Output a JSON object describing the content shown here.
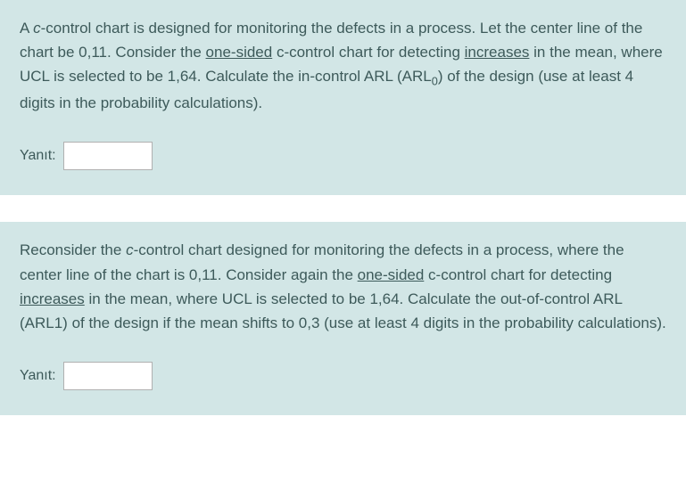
{
  "question1": {
    "text_parts": {
      "p1": "A ",
      "p2": "c",
      "p3": "-control chart is designed for monitoring the defects in a process. Let the center line of the chart be 0,11. Consider the ",
      "p4": "one-sided",
      "p5": " c-control chart for detecting ",
      "p6": "increases",
      "p7": " in the mean, where UCL is selected to be 1,64. Calculate the in-control ARL (ARL",
      "p8": "0",
      "p9": ") of the design (use at least 4 digits in the probability calculations)."
    },
    "answer_label": "Yanıt:",
    "answer_value": ""
  },
  "question2": {
    "text_parts": {
      "p1": "Reconsider the ",
      "p2": "c",
      "p3": "-control chart designed for monitoring the defects in a process, where the center line of the chart is 0,11. Consider again the ",
      "p4": "one-sided",
      "p5": " c-control chart for detecting ",
      "p6": "increases",
      "p7": " in the mean, where UCL is selected to be 1,64. Calculate the out-of-control ARL (ARL1) of the design if the mean shifts to 0,3 (use at least 4 digits in the probability calculations)."
    },
    "answer_label": "Yanıt:",
    "answer_value": ""
  }
}
